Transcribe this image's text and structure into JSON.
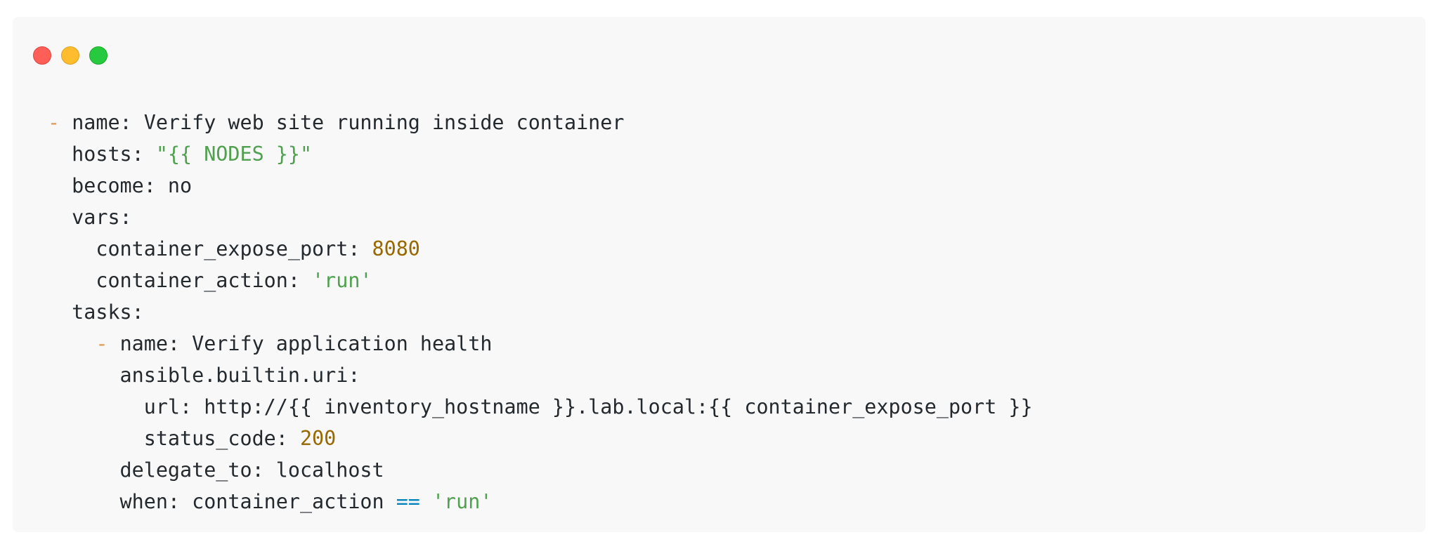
{
  "window": {
    "dots": {
      "close": "#ff5f56",
      "minimize": "#ffbd2e",
      "maximize": "#27c93f"
    },
    "background": "#f8f8f9"
  },
  "colors": {
    "text": "#24292e",
    "dash": "#e69a52",
    "string": "#50a14f",
    "number": "#986801",
    "operator": "#0184bc"
  },
  "code": {
    "lines": [
      [
        {
          "t": "- ",
          "k": "dash"
        },
        {
          "t": "name: Verify web site running inside container",
          "k": "plain"
        }
      ],
      [
        {
          "t": "  hosts: ",
          "k": "plain"
        },
        {
          "t": "\"{{ NODES }}\"",
          "k": "string"
        }
      ],
      [
        {
          "t": "  become: no",
          "k": "plain"
        }
      ],
      [
        {
          "t": "  vars:",
          "k": "plain"
        }
      ],
      [
        {
          "t": "    container_expose_port: ",
          "k": "plain"
        },
        {
          "t": "8080",
          "k": "number"
        }
      ],
      [
        {
          "t": "    container_action: ",
          "k": "plain"
        },
        {
          "t": "'run'",
          "k": "string"
        }
      ],
      [
        {
          "t": "  tasks:",
          "k": "plain"
        }
      ],
      [
        {
          "t": "    ",
          "k": "plain"
        },
        {
          "t": "- ",
          "k": "dash"
        },
        {
          "t": "name: Verify application health",
          "k": "plain"
        }
      ],
      [
        {
          "t": "      ansible.builtin.uri:",
          "k": "plain"
        }
      ],
      [
        {
          "t": "        url: http://{{ inventory_hostname }}.lab.local:{{ container_expose_port }}",
          "k": "plain"
        }
      ],
      [
        {
          "t": "        status_code: ",
          "k": "plain"
        },
        {
          "t": "200",
          "k": "number"
        }
      ],
      [
        {
          "t": "      delegate_to: localhost",
          "k": "plain"
        }
      ],
      [
        {
          "t": "      when: container_action ",
          "k": "plain"
        },
        {
          "t": "==",
          "k": "operator"
        },
        {
          "t": " ",
          "k": "plain"
        },
        {
          "t": "'run'",
          "k": "string"
        }
      ]
    ]
  }
}
